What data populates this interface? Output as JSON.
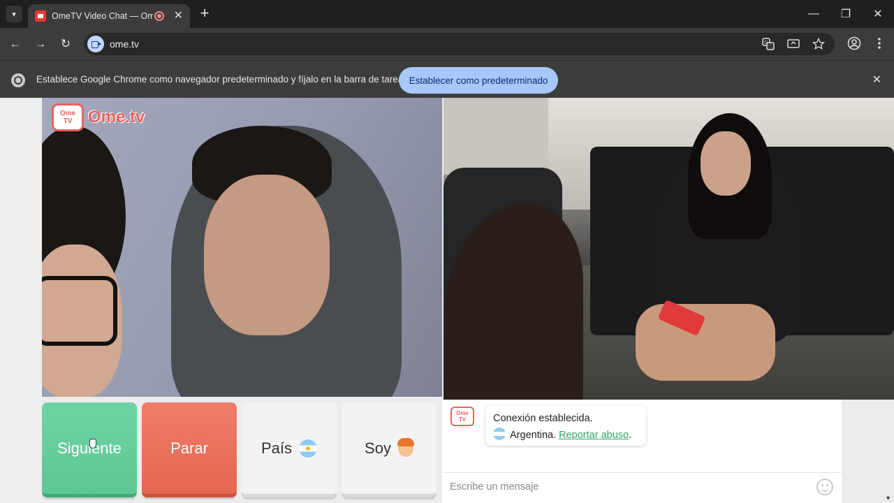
{
  "browser": {
    "tab_title": "OmeTV Video Chat — Ome",
    "tab_close": "✕",
    "new_tab": "+",
    "url": "ome.tv",
    "window_controls": {
      "minimize": "—",
      "restore": "❐",
      "close": "✕"
    },
    "nav": {
      "back": "←",
      "forward": "→",
      "reload": "↻"
    }
  },
  "infobar": {
    "message": "Establece Google Chrome como navegador predeterminado y fíjalo en la barra de tareas",
    "button_label": "Establecer como predeterminado",
    "close": "✕"
  },
  "logo": {
    "line1": "Ome",
    "line2": "TV",
    "text": "Ome.tv"
  },
  "controls": {
    "next_label": "Siguiente",
    "stop_label": "Parar",
    "country_label": "País",
    "gender_label": "Soy"
  },
  "chat": {
    "logo_line1": "Ome",
    "logo_line2": "TV",
    "status": "Conexión establecida.",
    "country": "Argentina.",
    "report_link": "Reportar abuso",
    "report_suffix": ".",
    "input_placeholder": "Escribe un mensaje"
  },
  "colors": {
    "next": "#5ec795",
    "stop": "#e56752",
    "brand": "#e8635c",
    "link": "#2ea86b",
    "infobar_button": "#a8c7fa"
  },
  "icons": {
    "tab_menu": "chevron-down-icon",
    "translate": "translate-icon",
    "cast": "cast-icon",
    "bookmark": "star-icon",
    "profile": "profile-icon",
    "menu": "kebab-menu-icon"
  }
}
